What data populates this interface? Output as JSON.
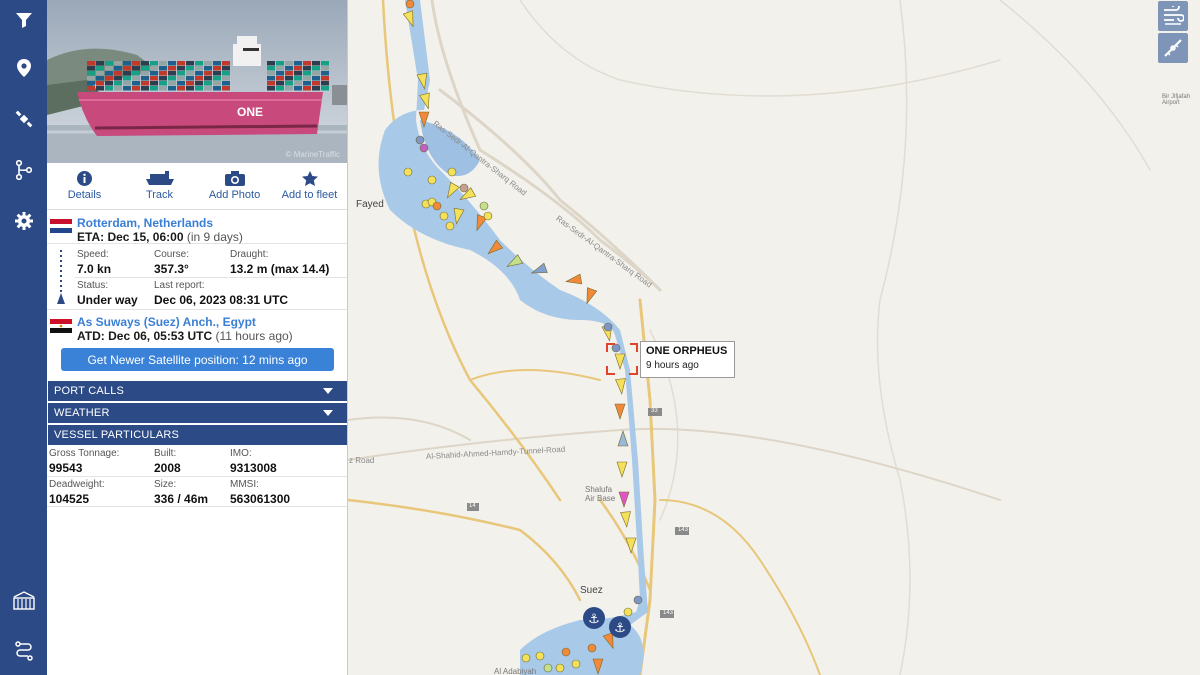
{
  "nav": {
    "items": [
      "filter-icon",
      "location-pin-icon",
      "satellite-icon",
      "route-branch-icon",
      "settings-gear-icon",
      "port-gate-icon",
      "route-path-icon"
    ]
  },
  "vessel": {
    "actions": [
      {
        "label": "Details",
        "icon": "info-icon"
      },
      {
        "label": "Track",
        "icon": "ship-track-icon"
      },
      {
        "label": "Add Photo",
        "icon": "camera-icon"
      },
      {
        "label": "Add to fleet",
        "icon": "star-icon"
      }
    ],
    "destination": {
      "port": "Rotterdam, Netherlands",
      "eta_label": "ETA: Dec 15, 06:00",
      "eta_relative": "(in 9 days)"
    },
    "voyage": {
      "speed_label": "Speed:",
      "speed": "7.0 kn",
      "course_label": "Course:",
      "course": "357.3°",
      "draught_label": "Draught:",
      "draught": "13.2 m (max 14.4)",
      "status_label": "Status:",
      "status": "Under way",
      "last_report_label": "Last report:",
      "last_report": "Dec 06, 2023 08:31 UTC"
    },
    "departure": {
      "port": "As Suways (Suez) Anch., Egypt",
      "atd_label": "ATD: Dec 06, 05:53 UTC",
      "atd_relative": "(11 hours ago)"
    },
    "satellite_button": "Get Newer Satellite position: 12 mins ago",
    "sections": {
      "port_calls": "PORT CALLS",
      "weather": "WEATHER",
      "particulars": "VESSEL PARTICULARS"
    },
    "particulars": {
      "gross_tonnage_label": "Gross Tonnage:",
      "gross_tonnage": "99543",
      "built_label": "Built:",
      "built": "2008",
      "imo_label": "IMO:",
      "imo": "9313008",
      "deadweight_label": "Deadweight:",
      "deadweight": "104525",
      "size_label": "Size:",
      "size": "336 / 46m",
      "mmsi_label": "MMSI:",
      "mmsi": "563061300"
    }
  },
  "map": {
    "selected_vessel": {
      "name": "ONE ORPHEUS",
      "age": "9 hours ago"
    },
    "tools": [
      "wind-layer-icon",
      "measure-ruler-icon"
    ],
    "labels": {
      "fayed": "Fayed",
      "suez": "Suez",
      "shalufa": "Shalufa\nAir Base",
      "adabiyah": "Al Adabiyah",
      "road1": "Ras-Sedr-Al-Qantra-Sharq Road",
      "road2": "Ras-Sedr-Al-Qantra-Sharq Road",
      "road3": "Al-Shahid-Ahmed-Hamdy-Tunnel-Road",
      "road4": "z Road",
      "route_33": "33",
      "route_143a": "143",
      "route_143b": "143",
      "route_14": "14",
      "bir_jifjafah": "Bir Jifjafah\nAirport"
    },
    "colors": {
      "water": "#a9c9e8",
      "land": "#f3f1ec",
      "road": "#e8c77a",
      "nav": "#2c4a86",
      "link": "#3a7fd5",
      "target": "#e0442c"
    }
  }
}
